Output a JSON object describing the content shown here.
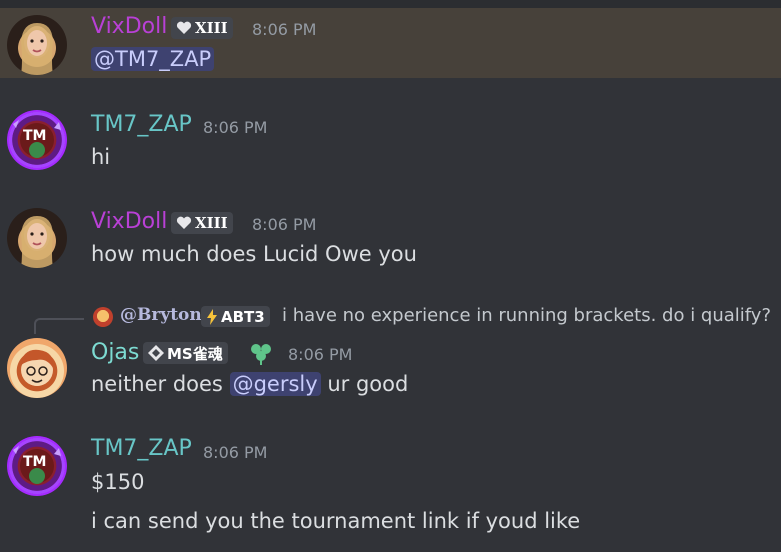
{
  "messages": [
    {
      "author": "VixDoll",
      "badge_icon": "heart-icon",
      "badge_text": "XIII",
      "time": "8:06 PM",
      "content_mention": "@TM7_ZAP",
      "highlighted": true
    },
    {
      "author": "TM7_ZAP",
      "time": "8:06 PM",
      "content": "hi"
    },
    {
      "author": "VixDoll",
      "badge_icon": "heart-icon",
      "badge_text": "XIII",
      "time": "8:06 PM",
      "content": "how much does Lucid Owe you"
    },
    {
      "reply": {
        "author": "@Bryton",
        "badge_icon": "lightning-icon",
        "badge_text": "ABT3",
        "text": "i have no experience in running brackets. do i qualify?"
      },
      "author": "Ojas",
      "badge_icon": "diamond-icon",
      "badge_text": "MS雀魂",
      "extra_icon": "clover-icon",
      "time": "8:06 PM",
      "content_pre": "neither does",
      "content_mention": "@gersly",
      "content_post": "ur good"
    },
    {
      "author": "TM7_ZAP",
      "time": "8:06 PM",
      "content": "$150",
      "content_2": "i can send you the tournament link if youd like"
    }
  ],
  "colors": {
    "background": "#313338",
    "highlight": "#47413a",
    "mention_bg": "#3e4270",
    "mention_text": "#c9cdfb",
    "vixdoll_name": "#b940d6",
    "tm7_name": "#68c6c7",
    "ojas_name": "#7ddbd2",
    "timestamp": "#949ba4",
    "text": "#dbdee1"
  }
}
